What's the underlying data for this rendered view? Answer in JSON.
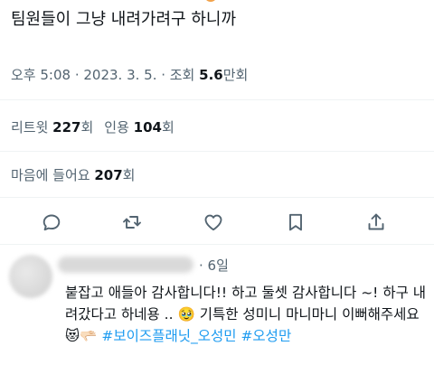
{
  "tweet": {
    "text": "팀원들이 그냥 내려가려구 하니까",
    "meta_prefix": "오후 5:08 · 2023. 3. 5. · 조회 ",
    "views_count": "5.6",
    "views_unit": "만회"
  },
  "stats": {
    "retweets_label": "리트윗 ",
    "retweets_count": "227",
    "retweets_unit": "회",
    "quotes_label": "인용 ",
    "quotes_count": "104",
    "quotes_unit": "회",
    "likes_label": "마음에 들어요 ",
    "likes_count": "207",
    "likes_unit": "회"
  },
  "actions": [
    {
      "icon": "reply-icon"
    },
    {
      "icon": "retweet-icon"
    },
    {
      "icon": "like-icon"
    },
    {
      "icon": "bookmark-icon"
    },
    {
      "icon": "share-icon"
    }
  ],
  "reply": {
    "time": "· 6일",
    "body_part1": "붙잡고 애들아 감사합니다!! 하고 둘셋 감사합니다 ~! 하구 내려갔다고 하네용 .. ",
    "emoji_1": "🥹",
    "body_part2": " 기특한 성미니 마니마니 이뻐해주세요 ",
    "emoji_2": "😻",
    "emoji_3": "🫳🏻",
    "hashtag_1": "#보이즈플래닛_오성민",
    "hashtag_2": "#오성만"
  },
  "colors": {
    "text": "#0f1419",
    "secondary": "#536471",
    "accent": "#1d9bf0",
    "divider": "#eff3f4"
  }
}
